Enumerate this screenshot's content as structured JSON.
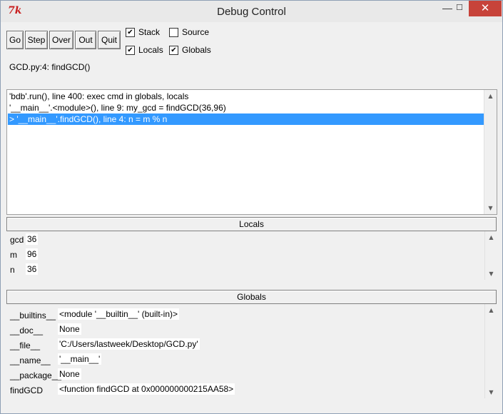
{
  "window": {
    "title": "Debug Control",
    "app_icon": "tk-icon",
    "minimize": "—",
    "maximize": "☐",
    "close": "✕"
  },
  "toolbar": {
    "go": "Go",
    "step": "Step",
    "over": "Over",
    "out": "Out",
    "quit": "Quit"
  },
  "options": {
    "stack": {
      "label": "Stack",
      "checked": true
    },
    "source": {
      "label": "Source",
      "checked": false
    },
    "locals": {
      "label": "Locals",
      "checked": true
    },
    "globals": {
      "label": "Globals",
      "checked": true
    }
  },
  "status": "GCD.py:4: findGCD()",
  "stack": [
    "'bdb'.run(), line 400: exec cmd in globals, locals",
    "'__main__'.<module>(), line 9: my_gcd = findGCD(36,96)",
    "> '__main__'.findGCD(), line 4: n = m % n"
  ],
  "locals": {
    "header": "Locals",
    "vars": [
      {
        "name": "gcd",
        "value": "36"
      },
      {
        "name": "m",
        "value": "96"
      },
      {
        "name": "n",
        "value": "36"
      }
    ]
  },
  "globals": {
    "header": "Globals",
    "vars": [
      {
        "name": "__builtins__",
        "value": "<module '__builtin__' (built-in)>"
      },
      {
        "name": "__doc__",
        "value": "None"
      },
      {
        "name": "__file__",
        "value": "'C:/Users/lastweek/Desktop/GCD.py'"
      },
      {
        "name": "__name__",
        "value": "'__main__'"
      },
      {
        "name": "__package__",
        "value": "None"
      },
      {
        "name": "findGCD",
        "value": "<function findGCD at 0x000000000215AA58>"
      }
    ]
  }
}
